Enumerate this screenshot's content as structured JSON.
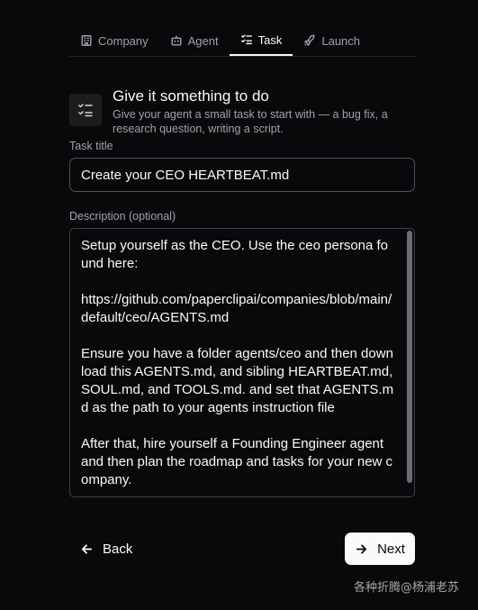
{
  "tabs": [
    {
      "label": "Company",
      "icon": "building-icon"
    },
    {
      "label": "Agent",
      "icon": "bot-icon"
    },
    {
      "label": "Task",
      "icon": "list-checks-icon",
      "active": true
    },
    {
      "label": "Launch",
      "icon": "rocket-icon"
    }
  ],
  "header": {
    "icon": "list-checks-icon",
    "title": "Give it something to do",
    "subtitle": "Give your agent a small task to start with — a bug fix, a research question, writing a script."
  },
  "form": {
    "task_title_label": "Task title",
    "task_title_value": "Create your CEO HEARTBEAT.md",
    "description_label": "Description (optional)",
    "description_value": "Setup yourself as the CEO. Use the ceo persona found here:\n\nhttps://github.com/paperclipai/companies/blob/main/default/ceo/AGENTS.md\n\nEnsure you have a folder agents/ceo and then download this AGENTS.md, and sibling HEARTBEAT.md, SOUL.md, and TOOLS.md. and set that AGENTS.md as the path to your agents instruction file\n\nAfter that, hire yourself a Founding Engineer agent and then plan the roadmap and tasks for your new company."
  },
  "footer": {
    "back_label": "Back",
    "next_label": "Next"
  },
  "watermark": "各种折腾@杨浦老苏",
  "colors": {
    "background": "#09090b",
    "primary_button": "#fafafa",
    "muted_text": "#a1a1aa",
    "border": "#3f3f46"
  }
}
